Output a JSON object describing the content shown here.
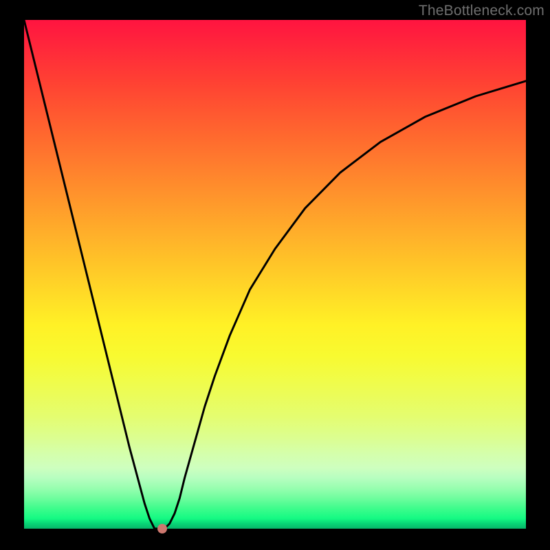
{
  "watermark": "TheBottleneck.com",
  "chart_data": {
    "type": "line",
    "title": "",
    "xlabel": "",
    "ylabel": "",
    "xlim": [
      0,
      100
    ],
    "ylim": [
      0,
      100
    ],
    "grid": false,
    "legend": false,
    "series": [
      {
        "name": "bottleneck-curve",
        "x": [
          0,
          3,
          6,
          9,
          12,
          15,
          18,
          21,
          24,
          25,
          26,
          27,
          28,
          29,
          30,
          31,
          32,
          34,
          36,
          38,
          41,
          45,
          50,
          56,
          63,
          71,
          80,
          90,
          100
        ],
        "y": [
          100,
          88,
          76,
          64,
          52,
          40,
          28,
          16,
          5,
          2,
          0,
          0,
          0,
          1,
          3,
          6,
          10,
          17,
          24,
          30,
          38,
          47,
          55,
          63,
          70,
          76,
          81,
          85,
          88
        ]
      }
    ],
    "marker": {
      "x": 27.5,
      "y": 0
    },
    "colors": {
      "line": "#000000",
      "marker": "#cd786f"
    }
  }
}
